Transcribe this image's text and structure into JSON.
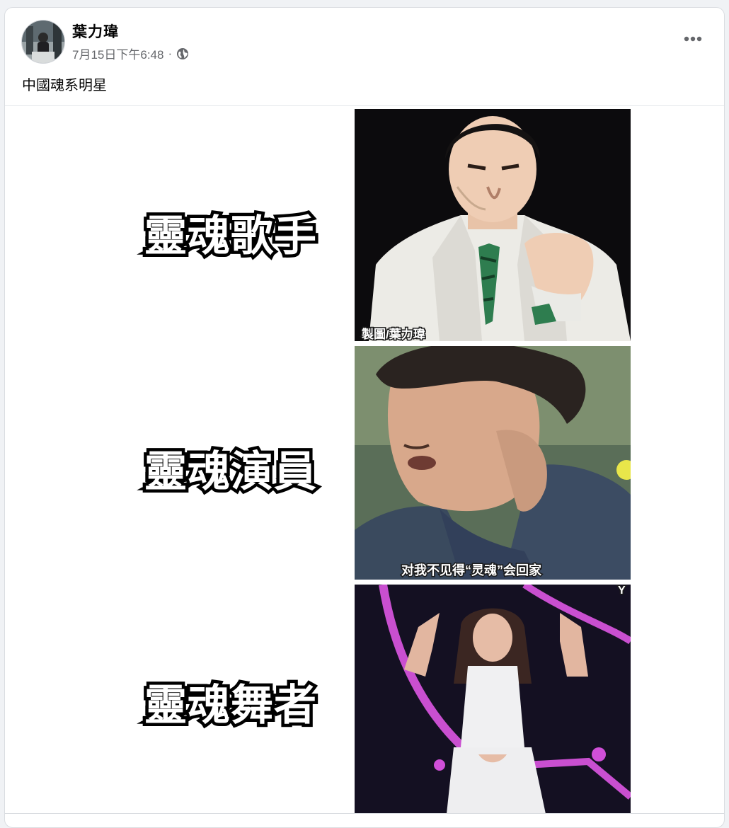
{
  "post": {
    "author": "葉力瑋",
    "timestamp": "7月15日下午6:48",
    "separator": "·",
    "audience_icon": "globe-icon",
    "more_icon": "more-horizontal-icon",
    "text": "中國魂系明星"
  },
  "image": {
    "rows": [
      {
        "label": "靈魂歌手",
        "caption": "製圖/葉力瑋"
      },
      {
        "label": "靈魂演員",
        "caption": "对我不见得“灵魂”会回家"
      },
      {
        "label": "靈魂舞者",
        "caption": "Y"
      }
    ]
  },
  "colors": {
    "background": "#f0f2f5",
    "card": "#ffffff",
    "text_primary": "#050505",
    "text_secondary": "#65676b"
  }
}
